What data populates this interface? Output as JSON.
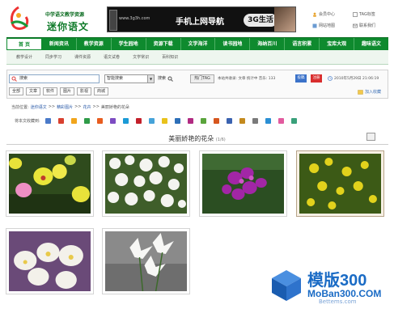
{
  "header": {
    "logo_sub": "中学语文教学资源",
    "logo_main": "迷你语文",
    "ad_url": "www.3g3h.com",
    "ad_text": "手机上网导航",
    "ad_tag": "3G生活",
    "top_links": [
      {
        "label": "会员中心",
        "icon": "user-icon"
      },
      {
        "label": "TAG标签",
        "icon": "tag-icon"
      },
      {
        "label": "网站地图",
        "icon": "sitemap-icon"
      },
      {
        "label": "联系我们",
        "icon": "mail-icon"
      }
    ]
  },
  "nav": {
    "items": [
      {
        "label": "首 页"
      },
      {
        "label": "新闻资讯"
      },
      {
        "label": "教学资源"
      },
      {
        "label": "学生园地"
      },
      {
        "label": "资源下载"
      },
      {
        "label": "文学海洋"
      },
      {
        "label": "读书园地"
      },
      {
        "label": "海纳百川"
      },
      {
        "label": "语言积累"
      },
      {
        "label": "宝库大观"
      },
      {
        "label": "趣味语文"
      }
    ],
    "sub_items": [
      "教学设计",
      "同步学习",
      "课件资源",
      "语文试卷",
      "文学常识",
      "百科知识"
    ]
  },
  "search": {
    "placeholder": "搜索",
    "select_value": "智能搜索",
    "search_button": "搜索",
    "hot_tag": "热门TAG",
    "info": "本站共收录: 文章 统计中  音乐: 133",
    "btn_a": "投稿",
    "btn_b": "注册",
    "date": "2010年5月29日  21:06:19",
    "filters": [
      "全部",
      "文章",
      "软件",
      "图片",
      "影视",
      "商城"
    ],
    "collect": "加入收藏"
  },
  "breadcrumb": {
    "prefix": "当前位置:",
    "items": [
      "迷你语文",
      "精彩图片",
      "花卉",
      "美丽娇艳的花朵"
    ],
    "sep": ">>"
  },
  "share": {
    "label": "将本文收藏到:",
    "colors": [
      "#4a7ac9",
      "#d8402f",
      "#f1a51c",
      "#2f9b48",
      "#e85d1f",
      "#7d4cc2",
      "#1b9ad6",
      "#c3202a",
      "#46a3d9",
      "#e9c21b",
      "#2d6fb8",
      "#b12a82",
      "#5aa43c",
      "#d6561e",
      "#3a62b0",
      "#c48a1e",
      "#7a7a7a",
      "#2b8fd4",
      "#e25b9f",
      "#39a07a"
    ]
  },
  "content": {
    "title": "美丽娇艳的花朵",
    "count": "(1/6)"
  },
  "watermark": {
    "line1": "模版300",
    "line2": "MoBan300.COM",
    "line3": "Bettems.com"
  }
}
